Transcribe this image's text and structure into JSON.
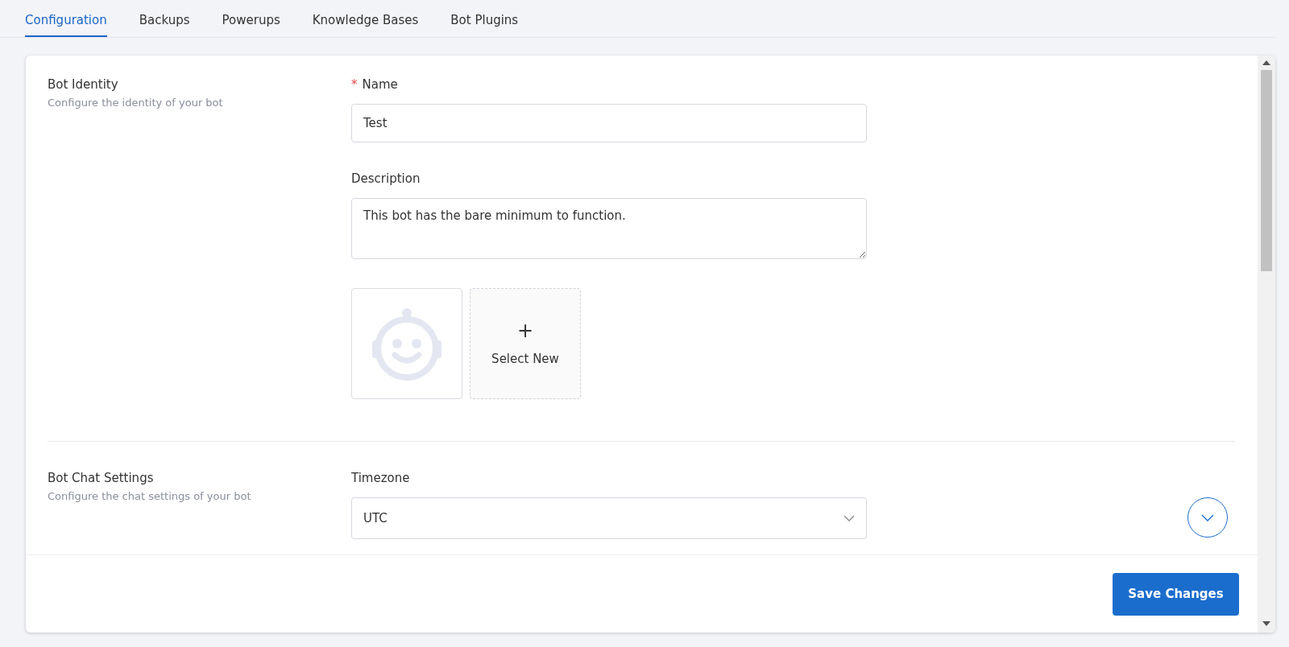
{
  "tabs": [
    {
      "label": "Configuration",
      "selected": true
    },
    {
      "label": "Backups",
      "selected": false
    },
    {
      "label": "Powerups",
      "selected": false
    },
    {
      "label": "Knowledge Bases",
      "selected": false
    },
    {
      "label": "Bot Plugins",
      "selected": false
    }
  ],
  "sections": [
    {
      "title": "Bot Identity",
      "subtitle": "Configure the identity of your bot",
      "fields": [
        {
          "kind": "text",
          "label": "Name",
          "required": true,
          "required_mark": "*",
          "value": "Test"
        },
        {
          "kind": "textarea",
          "label": "Description",
          "required": false,
          "value": "This bot has the bare minimum to function."
        },
        {
          "kind": "avatar",
          "upload_icon": "+",
          "upload_label": "Select New"
        }
      ]
    },
    {
      "title": "Bot Chat Settings",
      "subtitle": "Configure the chat settings of your bot",
      "fields": [
        {
          "kind": "select",
          "label": "Timezone",
          "required": false,
          "value": "UTC"
        }
      ]
    }
  ],
  "save_button": "Save Changes"
}
